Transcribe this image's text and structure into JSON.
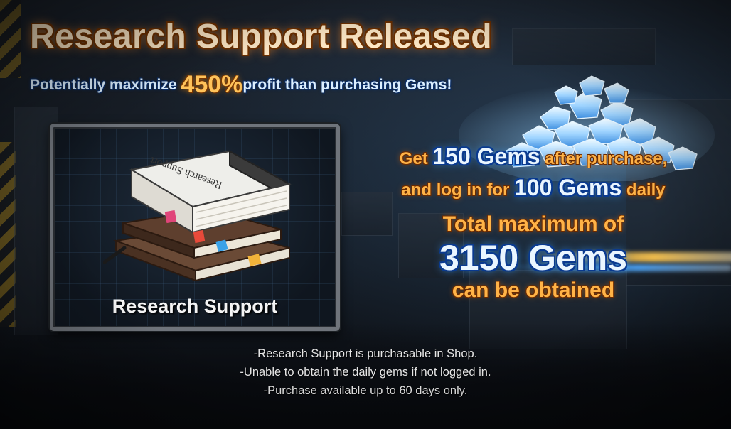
{
  "banner": {
    "title": "Research Support Released",
    "subtitle": {
      "prefix": "Potentially maximize ",
      "percent": "450%",
      "suffix": "profit than purchasing Gems!"
    }
  },
  "item": {
    "name": "Research Support",
    "book_cover_text": "Research Support",
    "icon": "books-icon"
  },
  "info": {
    "line1": {
      "prefix": "Get ",
      "highlight": "150 Gems",
      "suffix": " after purchase,"
    },
    "line2": {
      "prefix": "and log in for ",
      "highlight": "100 Gems",
      "suffix": " daily"
    },
    "total_prefix": "Total maximum of",
    "total_value": "3150 Gems",
    "total_suffix": "can be obtained"
  },
  "notes": [
    "-Research Support is purchasable in Shop.",
    "-Unable to obtain the daily gems if not logged in.",
    "-Purchase available up to 60 days only."
  ],
  "colors": {
    "title_text": "#ffe9c7",
    "accent_orange": "#ffb347",
    "accent_blue": "#0a3a8f",
    "percent": "#ffc35a"
  }
}
